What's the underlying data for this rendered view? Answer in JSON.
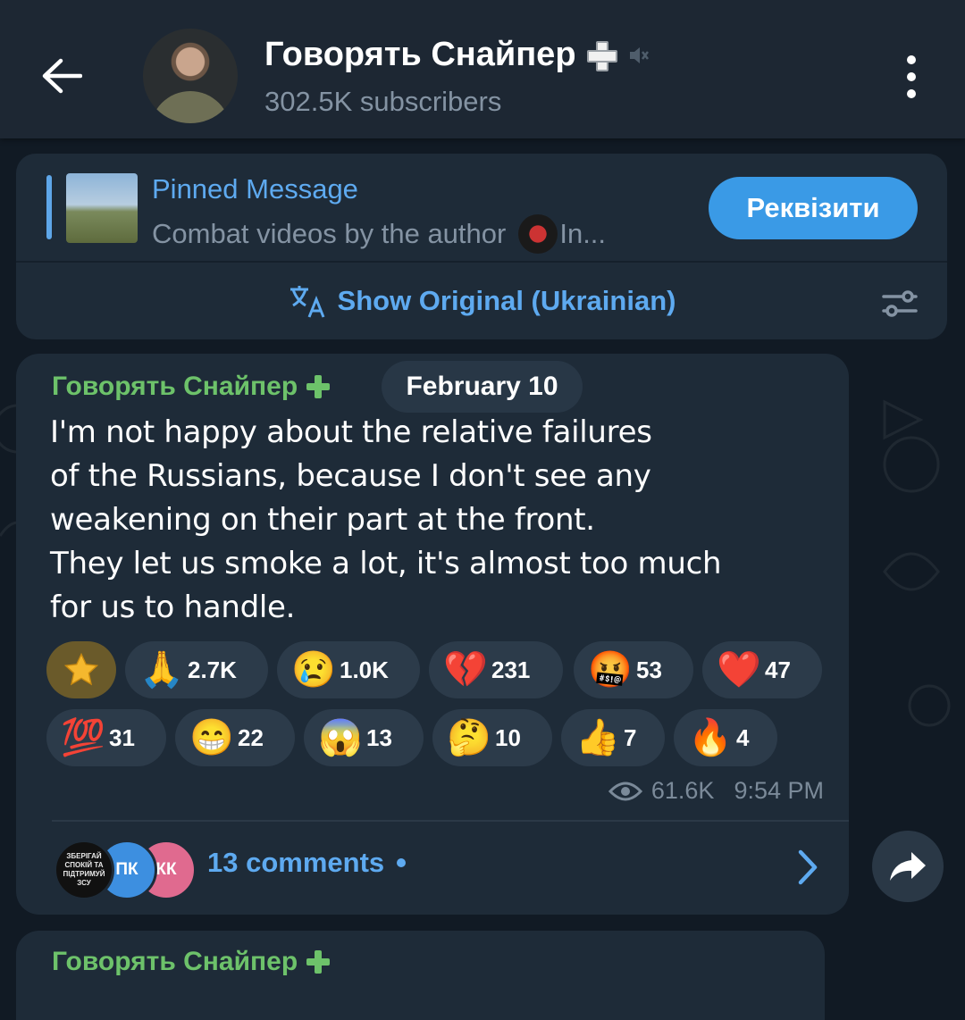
{
  "header": {
    "back_label": "Back",
    "title": "Говорять Снайпер",
    "subscribers": "302.5K subscribers"
  },
  "pinned": {
    "title": "Pinned Message",
    "text": "Combat videos by the author",
    "text_suffix": "In...",
    "button": "Реквізити",
    "translate": "Show Original (Ukrainian)"
  },
  "message": {
    "author": "Говорять Снайпер",
    "date": "February 10",
    "text": "I'm not happy about the relative failures\nof the Russians, because I don't see any\nweakening on their part at the front.\nThey let us smoke a lot, it's almost too much\nfor us to handle.",
    "reactions": [
      {
        "emoji": "🙏",
        "count": "2.7K"
      },
      {
        "emoji": "😢",
        "count": "1.0K"
      },
      {
        "emoji": "💔",
        "count": "231"
      },
      {
        "emoji": "🤬",
        "count": "53"
      },
      {
        "emoji": "❤️",
        "count": "47"
      },
      {
        "emoji": "💯",
        "count": "31"
      },
      {
        "emoji": "😁",
        "count": "22"
      },
      {
        "emoji": "😱",
        "count": "13"
      },
      {
        "emoji": "🤔",
        "count": "10"
      },
      {
        "emoji": "👍",
        "count": "7"
      },
      {
        "emoji": "🔥",
        "count": "4"
      }
    ],
    "views": "61.6K",
    "time": "9:54 PM",
    "comments": {
      "label": "13 comments",
      "avatars": [
        "ЗБЕРІГАЙ СПОКІЙ ТА ПІДТРИМУЙ ЗСУ",
        "ПК",
        "КК"
      ]
    }
  },
  "next_message": {
    "author": "Говорять Снайпер"
  },
  "colors": {
    "accent": "#5eaaf0",
    "author_green": "#6dc26a",
    "button_blue": "#3a9ae6",
    "bubble": "#1e2b38",
    "background": "#111a24"
  },
  "icons": {
    "back": "arrow-left-icon",
    "menu": "more-vertical-icon",
    "mute": "muted-icon",
    "translate": "translate-icon",
    "filter": "filter-settings-icon",
    "views": "eye-icon",
    "share": "share-forward-icon",
    "comments": "chevron-right-icon",
    "star": "star-icon"
  }
}
